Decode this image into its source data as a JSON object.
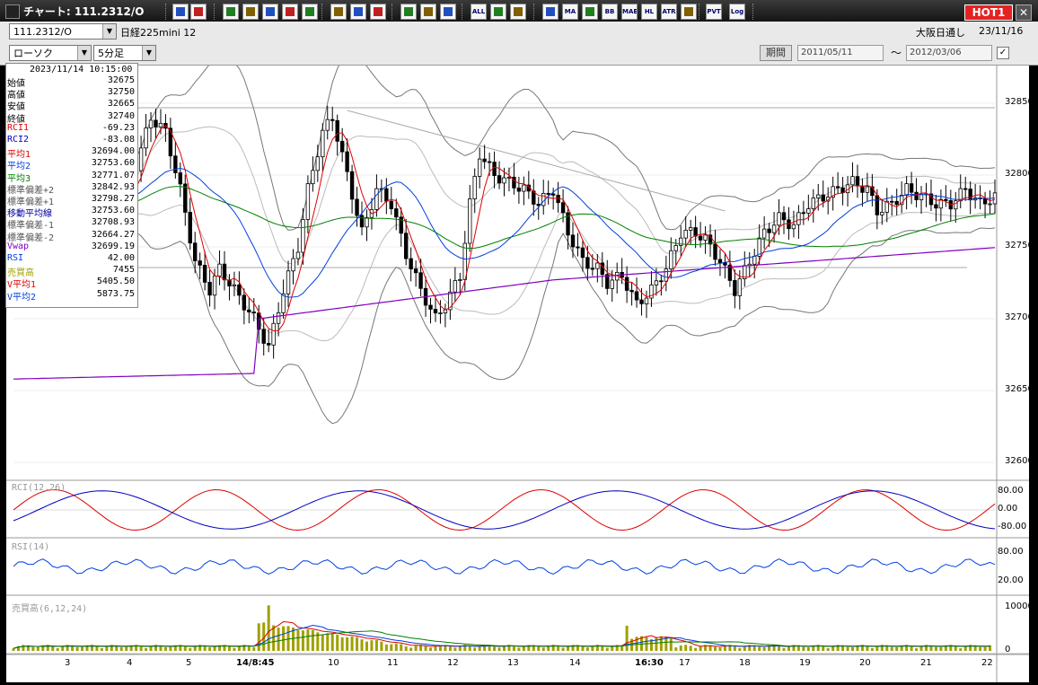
{
  "window": {
    "title": "チャート: 111.2312/O",
    "hot_badge": "HOT1",
    "close_label": "✕"
  },
  "infobar": {
    "symbol_code": "111.2312/O",
    "instrument_name": "日経225mini 12",
    "market": "大阪日通し",
    "date": "23/11/16"
  },
  "toolbar": {
    "chart_type": "ローソク",
    "interval": "5分足",
    "period_label": "期間",
    "date_from": "2011/05/11",
    "date_to": "2012/03/06",
    "tilde": "〜",
    "check": "✓",
    "buttons": [
      "zoom-in",
      "crosshair",
      "trend-line",
      "draw",
      "price-level",
      "channel",
      "rect",
      "warn",
      "pen",
      "select",
      "undo",
      "compare",
      "split",
      "clear-all",
      "settings",
      "tools",
      "palette",
      "ma",
      "ma-bb",
      "bb",
      "mae",
      "hl",
      "atr",
      "band",
      "pivot",
      "log",
      "export"
    ],
    "text_buttons": {
      "all": "ALL",
      "ma": "MA",
      "bb": "BB",
      "mae": "MAE",
      "hl": "HL",
      "atr": "ATR",
      "pvt": "PVT",
      "log": "Log"
    }
  },
  "info_panel": {
    "timestamp": "2023/11/14  10:15:00",
    "rows": [
      {
        "label": "始値",
        "value": "32675",
        "color": "#000000"
      },
      {
        "label": "高値",
        "value": "32750",
        "color": "#000000"
      },
      {
        "label": "安値",
        "value": "32665",
        "color": "#000000"
      },
      {
        "label": "終値",
        "value": "32740",
        "color": "#000000"
      },
      {
        "label": "RCI1",
        "value": "-69.23",
        "color": "#e00000"
      },
      {
        "label": "RCI2",
        "value": "-83.08",
        "color": "#0000c0"
      },
      {
        "label": "平均1",
        "value": "32694.00",
        "color": "#e00000"
      },
      {
        "label": "平均2",
        "value": "32753.60",
        "color": "#0040e0"
      },
      {
        "label": "平均3",
        "value": "32771.07",
        "color": "#008000"
      },
      {
        "label": "標準偏差+2",
        "value": "32842.93",
        "color": "#555555"
      },
      {
        "label": "標準偏差+1",
        "value": "32798.27",
        "color": "#555555"
      },
      {
        "label": "移動平均線",
        "value": "32753.60",
        "color": "#0000a0"
      },
      {
        "label": "標準偏差-1",
        "value": "32708.93",
        "color": "#555555"
      },
      {
        "label": "標準偏差-2",
        "value": "32664.27",
        "color": "#555555"
      },
      {
        "label": "Vwap",
        "value": "32699.19",
        "color": "#8000c0"
      },
      {
        "label": "RSI",
        "value": "42.00",
        "color": "#0040e0"
      },
      {
        "label": "売買高",
        "value": "7455",
        "color": "#a0a000"
      },
      {
        "label": "V平均1",
        "value": "5405.50",
        "color": "#e00000"
      },
      {
        "label": "V平均2",
        "value": "5873.75",
        "color": "#0040e0"
      }
    ]
  },
  "panels": {
    "rci_label": "RCI(12,26)",
    "rsi_label": "RSI(14)",
    "vol_label": "売買高(6,12,24)"
  },
  "chart_data": {
    "type": "candlestick",
    "price_axis": {
      "ticks": [
        "32850",
        "32800",
        "32750",
        "32700",
        "32650",
        "32600"
      ],
      "ylim": [
        32590,
        32870
      ]
    },
    "rci_axis": {
      "ticks": [
        "80.00",
        "0.00",
        "-80.00"
      ],
      "ylim": [
        -100,
        100
      ]
    },
    "rsi_axis": {
      "ticks": [
        "80.00",
        "20.00"
      ],
      "ylim": [
        0,
        100
      ]
    },
    "vol_axis": {
      "ticks": [
        "10000",
        "0"
      ],
      "ylim": [
        0,
        12000
      ]
    },
    "x_labels": [
      {
        "text": "3",
        "bold": false
      },
      {
        "text": "4",
        "bold": false
      },
      {
        "text": "5",
        "bold": false
      },
      {
        "text": "14/8:45",
        "bold": true
      },
      {
        "text": "10",
        "bold": false
      },
      {
        "text": "11",
        "bold": false
      },
      {
        "text": "12",
        "bold": false
      },
      {
        "text": "13",
        "bold": false
      },
      {
        "text": "14",
        "bold": false
      },
      {
        "text": "16:30",
        "bold": true
      },
      {
        "text": "17",
        "bold": false
      },
      {
        "text": "18",
        "bold": false
      },
      {
        "text": "19",
        "bold": false
      },
      {
        "text": "20",
        "bold": false
      },
      {
        "text": "21",
        "bold": false
      },
      {
        "text": "22",
        "bold": false
      }
    ],
    "close_path": [
      [
        0,
        32760
      ],
      [
        6,
        32775
      ],
      [
        12,
        32785
      ],
      [
        17,
        32790
      ],
      [
        23,
        32785
      ],
      [
        28,
        32840
      ],
      [
        31,
        32830
      ],
      [
        34,
        32790
      ],
      [
        37,
        32740
      ],
      [
        40,
        32720
      ],
      [
        42,
        32735
      ],
      [
        45,
        32720
      ],
      [
        49,
        32700
      ],
      [
        52,
        32680
      ],
      [
        55,
        32720
      ],
      [
        58,
        32750
      ],
      [
        60,
        32790
      ],
      [
        63,
        32830
      ],
      [
        65,
        32840
      ],
      [
        68,
        32800
      ],
      [
        71,
        32760
      ],
      [
        74,
        32790
      ],
      [
        77,
        32780
      ],
      [
        80,
        32745
      ],
      [
        83,
        32720
      ],
      [
        86,
        32700
      ],
      [
        88,
        32710
      ],
      [
        91,
        32730
      ],
      [
        93,
        32780
      ],
      [
        95,
        32815
      ],
      [
        98,
        32800
      ],
      [
        101,
        32795
      ],
      [
        104,
        32790
      ],
      [
        107,
        32780
      ],
      [
        110,
        32790
      ],
      [
        113,
        32760
      ],
      [
        116,
        32740
      ],
      [
        119,
        32735
      ],
      [
        121,
        32725
      ],
      [
        124,
        32730
      ],
      [
        127,
        32710
      ],
      [
        130,
        32720
      ],
      [
        133,
        32735
      ],
      [
        136,
        32760
      ],
      [
        139,
        32760
      ],
      [
        141,
        32755
      ],
      [
        144,
        32740
      ],
      [
        147,
        32720
      ],
      [
        150,
        32740
      ],
      [
        153,
        32760
      ],
      [
        156,
        32770
      ],
      [
        159,
        32765
      ],
      [
        162,
        32780
      ],
      [
        165,
        32785
      ],
      [
        168,
        32790
      ],
      [
        171,
        32795
      ],
      [
        174,
        32790
      ],
      [
        176,
        32775
      ],
      [
        179,
        32780
      ],
      [
        182,
        32790
      ],
      [
        185,
        32785
      ],
      [
        188,
        32780
      ],
      [
        191,
        32780
      ],
      [
        194,
        32790
      ],
      [
        197,
        32780
      ],
      [
        200,
        32785
      ]
    ]
  }
}
